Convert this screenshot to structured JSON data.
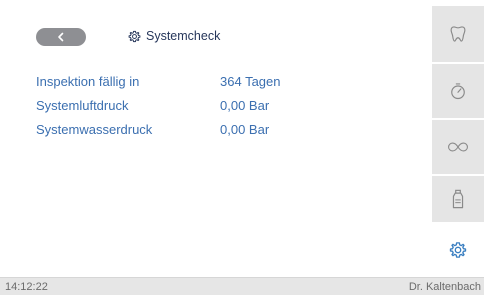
{
  "header": {
    "title": "Systemcheck",
    "back_icon": "chevron-left-icon",
    "title_icon": "gear-icon"
  },
  "rows": [
    {
      "label": "Inspektion fällig in",
      "value": "364 Tagen"
    },
    {
      "label": "Systemluftdruck",
      "value": "0,00 Bar"
    },
    {
      "label": "Systemwasserdruck",
      "value": "0,00 Bar"
    }
  ],
  "sidebar": {
    "items": [
      {
        "icon": "tooth-icon",
        "active": false
      },
      {
        "icon": "timer-icon",
        "active": false
      },
      {
        "icon": "infinity-icon",
        "active": false
      },
      {
        "icon": "bottle-icon",
        "active": false
      },
      {
        "icon": "gear-icon",
        "active": true
      }
    ]
  },
  "status": {
    "time": "14:12:22",
    "brand": "Dr. Kaltenbach"
  },
  "colors": {
    "accent": "#3a7fc1",
    "text_dark": "#26365a",
    "text_blue": "#3b6fb0",
    "sidebar_bg": "#e5e5e5",
    "back_button": "#8e8f93"
  }
}
